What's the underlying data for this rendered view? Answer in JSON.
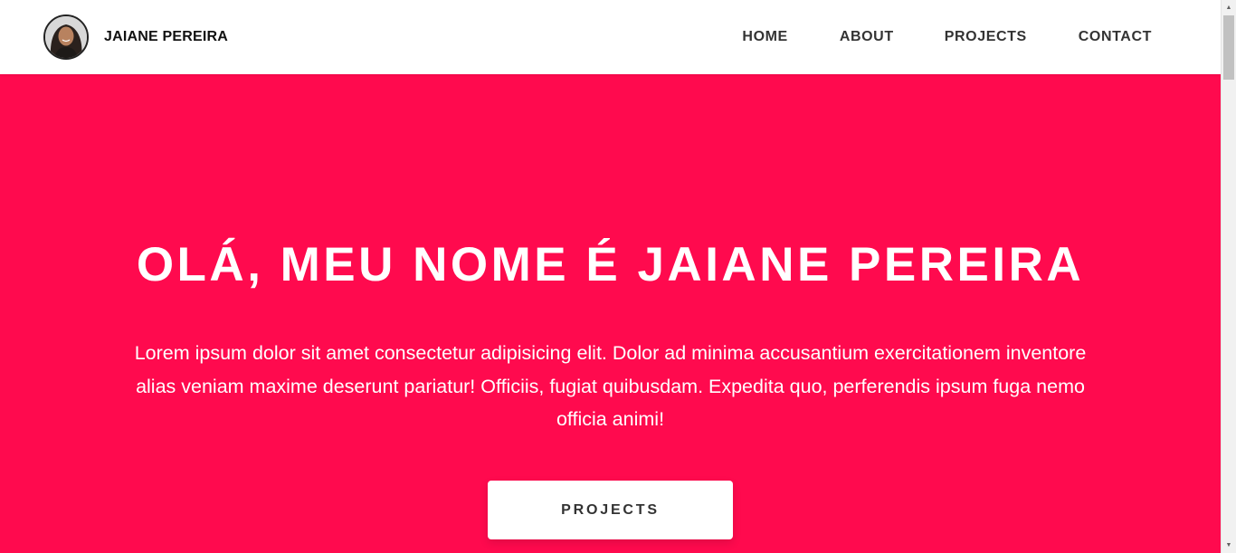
{
  "colors": {
    "accent": "#ff0a4e",
    "header_bg": "#ffffff",
    "text_dark": "#333333"
  },
  "header": {
    "avatar_icon": "profile-photo",
    "brand_name": "JAIANE PEREIRA",
    "nav": {
      "home": "HOME",
      "about": "ABOUT",
      "projects": "PROJECTS",
      "contact": "CONTACT"
    }
  },
  "hero": {
    "title": "OLÁ, MEU NOME É JAIANE PEREIRA",
    "text": "Lorem ipsum dolor sit amet consectetur adipisicing elit. Dolor ad minima accusantium exercitationem inventore alias veniam maxime deserunt pariatur! Officiis, fugiat quibusdam. Expedita quo, perferendis ipsum fuga nemo officia animi!",
    "button_label": "PROJECTS"
  },
  "scrollbar": {
    "up_icon": "arrow-up-icon",
    "down_icon": "arrow-down-icon"
  }
}
